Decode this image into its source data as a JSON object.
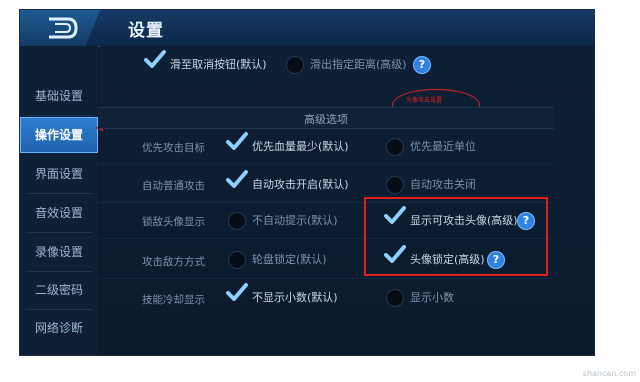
{
  "window": {
    "title": "设置"
  },
  "sidebar": {
    "items": [
      {
        "label": "基础设置",
        "active": false
      },
      {
        "label": "操作设置",
        "active": true
      },
      {
        "label": "界面设置",
        "active": false
      },
      {
        "label": "音效设置",
        "active": false
      },
      {
        "label": "录像设置",
        "active": false
      },
      {
        "label": "二级密码",
        "active": false
      },
      {
        "label": "网络诊断",
        "active": false
      }
    ]
  },
  "top_options": {
    "opt1": "滑至取消按钮(默认)",
    "opt2": "滑出指定距离(高级)"
  },
  "annotation": {
    "text": "头像攻击设置"
  },
  "section": {
    "title": "高级选项"
  },
  "rows": [
    {
      "label": "优先攻击目标",
      "left": "优先血量最少(默认)",
      "right": "优先最近单位"
    },
    {
      "label": "自动普通攻击",
      "left": "自动攻击开启(默认)",
      "right": "自动攻击关闭"
    },
    {
      "label": "锁敌头像显示",
      "left": "不自动提示(默认)",
      "right": "显示可攻击头像(高级)"
    },
    {
      "label": "攻击敌方方式",
      "left": "轮盘锁定(默认)",
      "right": "头像锁定(高级)"
    },
    {
      "label": "技能冷却显示",
      "left": "不显示小数(默认)",
      "right": "显示小数"
    }
  ],
  "help_icon": "?",
  "watermark": "shancan.com",
  "colors": {
    "accent": "#2f82e0",
    "active_tab": "#1e63ad",
    "highlight": "#e02020",
    "background": "#0b1a2c"
  }
}
